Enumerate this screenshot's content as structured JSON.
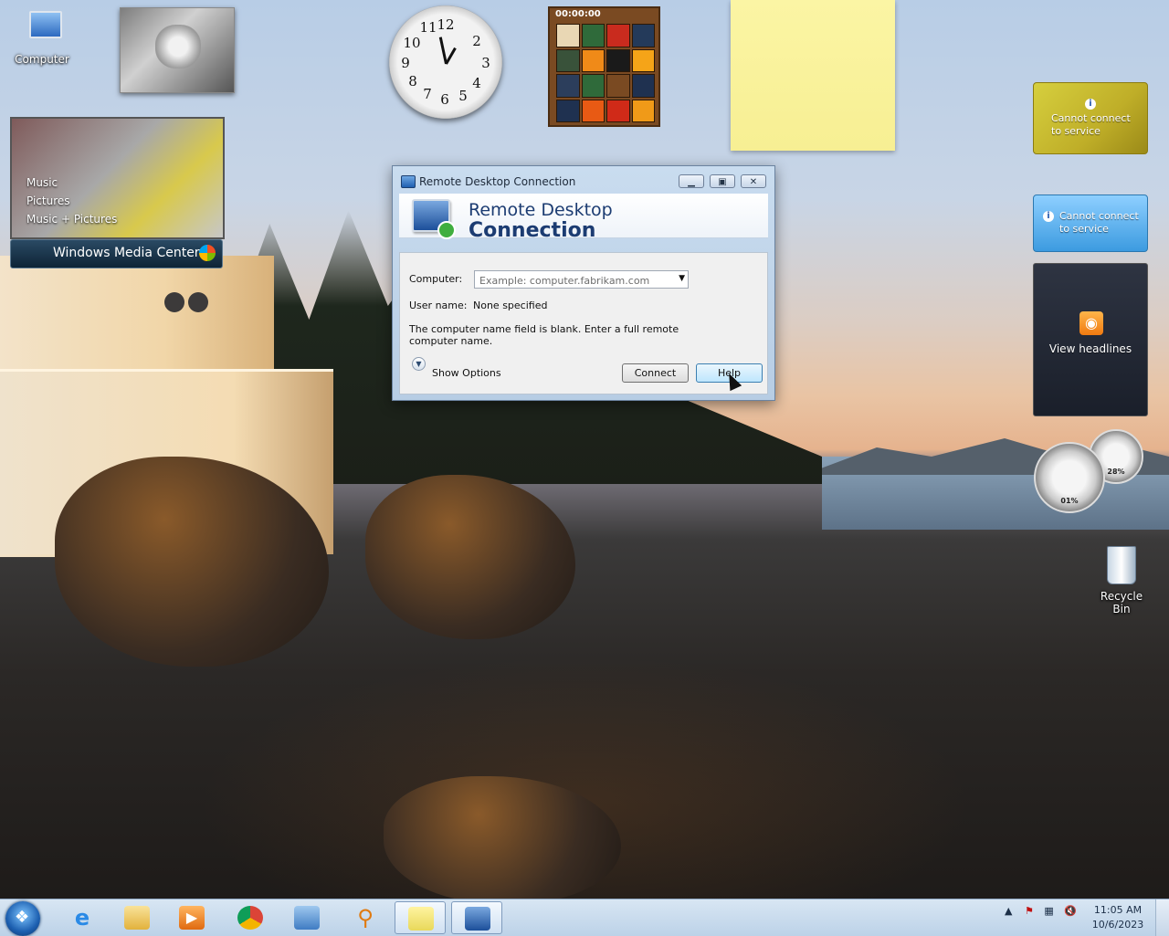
{
  "desktop": {
    "icons": [
      {
        "label": "Computer"
      },
      {
        "label": "Recycle Bin"
      }
    ]
  },
  "gadgets": {
    "puzzle": {
      "timer": "00:00:00"
    },
    "media_center": {
      "items": [
        "Music",
        "Pictures",
        "Music + Pictures"
      ],
      "bar_label": "Windows Media Center"
    },
    "weather": {
      "message": "Cannot connect to service"
    },
    "currency": {
      "message": "Cannot connect to service"
    },
    "feed": {
      "label": "View headlines"
    },
    "cpu_meter": {
      "cpu": "01%",
      "memory": "28%"
    }
  },
  "dialog": {
    "title": "Remote Desktop Connection",
    "banner_line1": "Remote Desktop",
    "banner_line2": "Connection",
    "computer_label": "Computer:",
    "computer_placeholder": "Example: computer.fabrikam.com",
    "username_label": "User name:",
    "username_value": "None specified",
    "message": "The computer name field is blank. Enter a full remote computer name.",
    "show_options": "Show Options",
    "connect": "Connect",
    "help": "Help"
  },
  "taskbar": {
    "time": "11:05 AM",
    "date": "10/6/2023",
    "apps": [
      "internet-explorer",
      "file-explorer",
      "media-player",
      "chrome",
      "control-panel",
      "search",
      "sticky-notes",
      "remote-desktop"
    ]
  }
}
